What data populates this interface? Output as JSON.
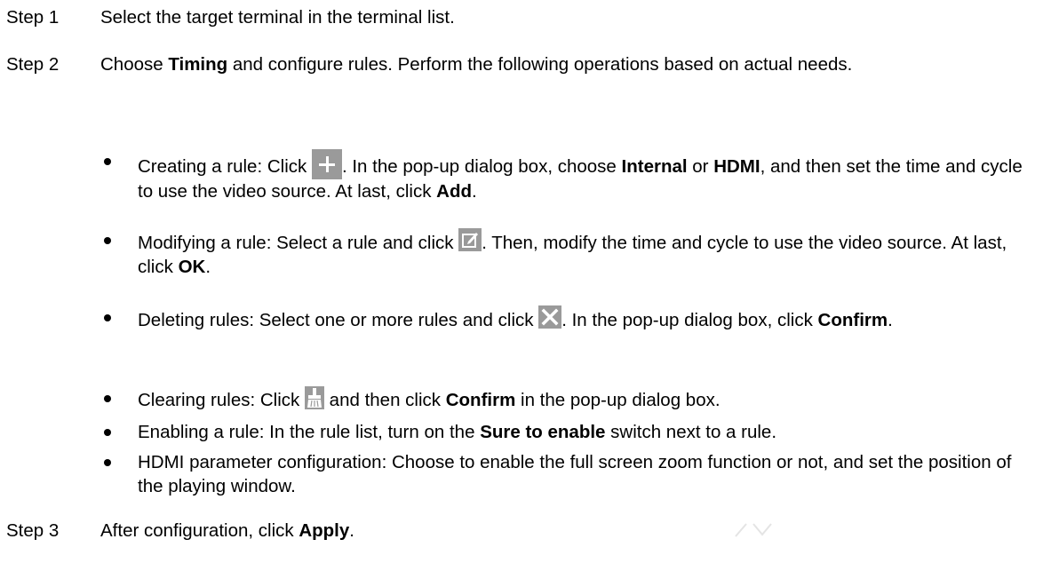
{
  "steps": {
    "s1": {
      "num": "Step 1",
      "text": "Select the target terminal in the terminal list."
    },
    "s2": {
      "num": "Step 2",
      "t1": "Choose ",
      "b1": "Timing",
      "t2": " and configure rules. Perform the following operations based on actual needs."
    },
    "s3": {
      "num": "Step 3",
      "t1": "After configuration, click ",
      "b1": "Apply",
      "t2": "."
    }
  },
  "bullets": {
    "create": {
      "t1": "Creating a rule: Click ",
      "t2": ". In the pop-up dialog box, choose ",
      "b1": "Internal",
      "t3": " or ",
      "b2": "HDMI",
      "t4": ", and then set the time and cycle to use the video source. At last, click ",
      "b3": "Add",
      "t5": "."
    },
    "modify": {
      "t1": "Modifying a rule: Select a rule and click ",
      "t2": ". Then, modify the time and cycle to use the video source. At last, click ",
      "b1": "OK",
      "t3": "."
    },
    "delete": {
      "t1": "Deleting rules: Select one or more rules and click ",
      "t2": ". In the pop-up dialog box, click ",
      "b1": "Confirm",
      "t3": "."
    },
    "clear": {
      "t1": "Clearing rules: Click ",
      "t2": " and then click ",
      "b1": "Confirm",
      "t3": " in the pop-up dialog box."
    },
    "enable": {
      "t1": "Enabling a rule: In the rule list, turn on the ",
      "b1": "Sure to enable",
      "t2": " switch next to a rule."
    },
    "hdmi": {
      "t1": "HDMI parameter configuration: Choose to enable the full screen zoom function or not, and set the position of the playing window."
    }
  },
  "icons": {
    "add": "plus-icon",
    "edit": "edit-icon",
    "delete": "close-icon",
    "clear": "broom-icon",
    "icon_color": "#9a9a9a"
  }
}
